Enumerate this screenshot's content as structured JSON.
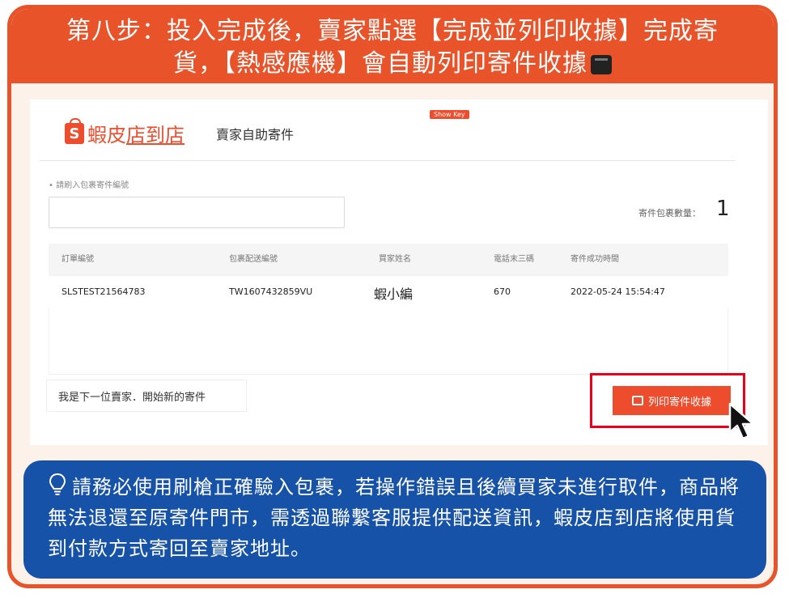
{
  "header": {
    "line1": "第八步：投入完成後，賣家點選【完成並列印收據】完成寄",
    "line2": "貨，【熱感應機】會自動列印寄件收據"
  },
  "app": {
    "logo_text_a": "蝦皮",
    "logo_text_b": "店到店",
    "logo_icon_letter": "S",
    "subtitle": "賣家自助寄件",
    "show_key": "Show Key"
  },
  "form": {
    "label": "• 請刷入包裹寄件編號",
    "input_value": "",
    "count_label": "寄件包裹數量：",
    "count_value": "1"
  },
  "table": {
    "headers": [
      "訂單編號",
      "包裹配送編號",
      "買家姓名",
      "電話末三碼",
      "寄件成功時間"
    ],
    "rows": [
      [
        "SLSTEST21564783",
        "TW1607432859VU",
        "蝦小編",
        "670",
        "2022-05-24 15:54:47"
      ]
    ]
  },
  "buttons": {
    "next_seller": "我是下一位賣家．開始新的寄件",
    "print_receipt": "列印寄件收據"
  },
  "note": {
    "text": "請務必使用刷槍正確驗入包裹，若操作錯誤且後續買家未進行取件，商品將無法退還至原寄件門市，需透過聯繫客服提供配送資訊，蝦皮店到店將使用貨到付款方式寄回至賣家地址。"
  },
  "colors": {
    "accent": "#e8532a",
    "brand": "#ee4d2d",
    "highlight": "#e8001c",
    "note_bg": "#1752a9"
  }
}
